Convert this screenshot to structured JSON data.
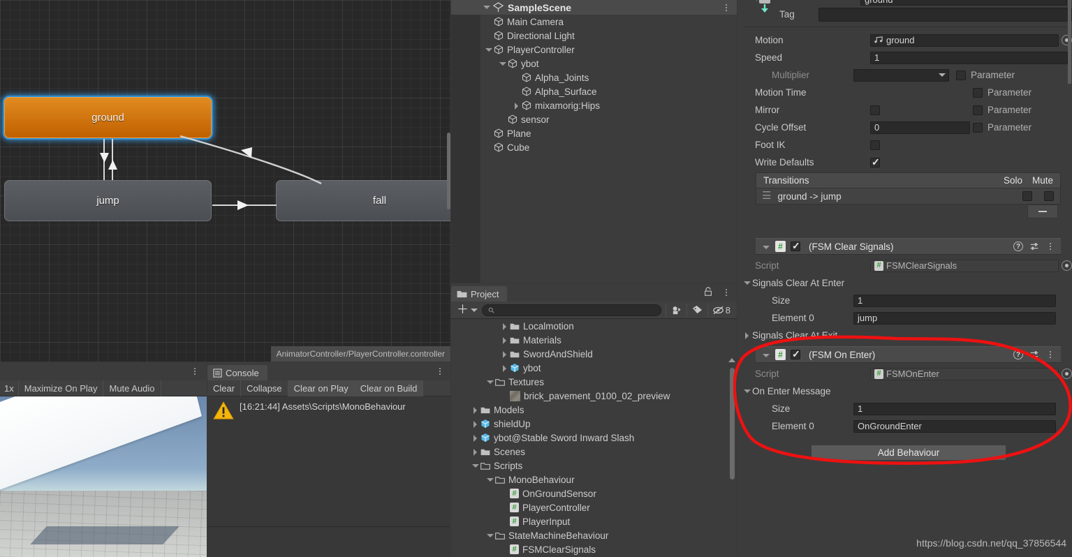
{
  "animator": {
    "states": [
      {
        "name": "ground",
        "selected": true
      },
      {
        "name": "jump",
        "selected": false
      },
      {
        "name": "fall",
        "selected": false
      }
    ],
    "controller_path": "AnimatorController/PlayerController.controller"
  },
  "hierarchy": {
    "root": "SampleScene",
    "items": [
      {
        "label": "Main Camera",
        "indent": 1,
        "arrow": "none"
      },
      {
        "label": "Directional Light",
        "indent": 1,
        "arrow": "none"
      },
      {
        "label": "PlayerController",
        "indent": 1,
        "arrow": "down"
      },
      {
        "label": "ybot",
        "indent": 2,
        "arrow": "down"
      },
      {
        "label": "Alpha_Joints",
        "indent": 3,
        "arrow": "none"
      },
      {
        "label": "Alpha_Surface",
        "indent": 3,
        "arrow": "none"
      },
      {
        "label": "mixamorig:Hips",
        "indent": 3,
        "arrow": "right"
      },
      {
        "label": "sensor",
        "indent": 2,
        "arrow": "none"
      },
      {
        "label": "Plane",
        "indent": 1,
        "arrow": "none"
      },
      {
        "label": "Cube",
        "indent": 1,
        "arrow": "none"
      }
    ]
  },
  "project": {
    "tab_label": "Project",
    "search_placeholder": "",
    "hidden_count": "8",
    "items": [
      {
        "label": "Localmotion",
        "indent": 3,
        "arrow": "right",
        "icon": "folder"
      },
      {
        "label": "Materials",
        "indent": 3,
        "arrow": "right",
        "icon": "folder"
      },
      {
        "label": "SwordAndShield",
        "indent": 3,
        "arrow": "right",
        "icon": "folder"
      },
      {
        "label": "ybot",
        "indent": 3,
        "arrow": "right",
        "icon": "prefab"
      },
      {
        "label": "Textures",
        "indent": 2,
        "arrow": "down",
        "icon": "folder-open"
      },
      {
        "label": "brick_pavement_0100_02_preview",
        "indent": 3,
        "arrow": "none",
        "icon": "texture"
      },
      {
        "label": "Models",
        "indent": 1,
        "arrow": "right",
        "icon": "folder"
      },
      {
        "label": "shieldUp",
        "indent": 1,
        "arrow": "right",
        "icon": "prefab"
      },
      {
        "label": "ybot@Stable Sword Inward Slash",
        "indent": 1,
        "arrow": "right",
        "icon": "prefab"
      },
      {
        "label": "Scenes",
        "indent": 1,
        "arrow": "right",
        "icon": "folder"
      },
      {
        "label": "Scripts",
        "indent": 1,
        "arrow": "down",
        "icon": "folder-open"
      },
      {
        "label": "MonoBehaviour",
        "indent": 2,
        "arrow": "down",
        "icon": "folder-open"
      },
      {
        "label": "OnGroundSensor",
        "indent": 3,
        "arrow": "none",
        "icon": "script"
      },
      {
        "label": "PlayerController",
        "indent": 3,
        "arrow": "none",
        "icon": "script"
      },
      {
        "label": "PlayerInput",
        "indent": 3,
        "arrow": "none",
        "icon": "script"
      },
      {
        "label": "StateMachineBehaviour",
        "indent": 2,
        "arrow": "down",
        "icon": "folder-open"
      },
      {
        "label": "FSMClearSignals",
        "indent": 3,
        "arrow": "none",
        "icon": "script"
      }
    ]
  },
  "gameview": {
    "scale_label": "1x",
    "maximize_label": "Maximize On Play",
    "mute_label": "Mute Audio"
  },
  "console": {
    "tab_label": "Console",
    "buttons": [
      "Clear",
      "Collapse",
      "Clear on Play",
      "Clear on Build"
    ],
    "log": "[16:21:44] Assets\\Scripts\\MonoBehaviour"
  },
  "inspector": {
    "name_value": "ground",
    "tag_label": "Tag",
    "tag_value": "",
    "motion": {
      "label": "Motion",
      "value": "ground"
    },
    "speed": {
      "label": "Speed",
      "value": "1"
    },
    "multiplier": {
      "label": "Multiplier",
      "value": "",
      "param_label": "Parameter"
    },
    "motion_time": {
      "label": "Motion Time",
      "param_label": "Parameter"
    },
    "mirror": {
      "label": "Mirror",
      "param_label": "Parameter"
    },
    "cycle_offset": {
      "label": "Cycle Offset",
      "value": "0",
      "param_label": "Parameter"
    },
    "foot_ik": {
      "label": "Foot IK"
    },
    "write_defaults": {
      "label": "Write Defaults"
    },
    "transitions": {
      "header": "Transitions",
      "solo_label": "Solo",
      "mute_label": "Mute",
      "row_label": "ground -> jump"
    },
    "clear_signals": {
      "title": "(FSM Clear Signals)",
      "script_label": "Script",
      "script_value": "FSMClearSignals",
      "enter_label": "Signals Clear At Enter",
      "size_label": "Size",
      "size_value": "1",
      "element_label": "Element 0",
      "element_value": "jump",
      "exit_label": "Signals Clear At Exit"
    },
    "on_enter": {
      "title": "(FSM On Enter)",
      "script_label": "Script",
      "script_value": "FSMOnEnter",
      "message_label": "On Enter Message",
      "size_label": "Size",
      "size_value": "1",
      "element_label": "Element 0",
      "element_value": "OnGroundEnter"
    },
    "add_behaviour_label": "Add Behaviour"
  },
  "watermark": "https://blog.csdn.net/qq_37856544",
  "colors": {
    "accent_orange": "#d07a10",
    "selection_blue": "#2d8fd8",
    "annotation_red": "#ee1111"
  }
}
